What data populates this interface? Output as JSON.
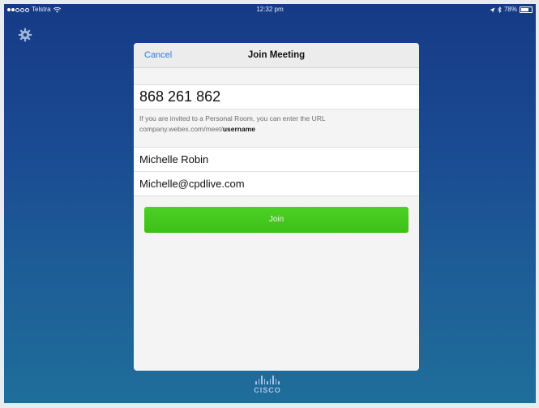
{
  "status_bar": {
    "carrier": "Telstra",
    "time": "12:32 pm",
    "battery": "78%"
  },
  "modal": {
    "cancel_label": "Cancel",
    "title": "Join Meeting",
    "meeting_number": "868 261 862",
    "hint_text": "If you are invited to a Personal Room, you can enter the URL company.webex.com/meet/",
    "hint_emphasis": "username",
    "name": "Michelle Robin",
    "email": "Michelle@cpdlive.com",
    "join_label": "Join"
  },
  "brand": {
    "logo_text": "CISCO"
  },
  "colors": {
    "background_top": "#163a86",
    "background_bottom": "#1f6e9a",
    "link_blue": "#2f7de1",
    "join_green": "#43c81f"
  },
  "icons": {
    "settings": "gear-icon",
    "wifi": "wifi-icon",
    "location": "location-arrow-icon",
    "bluetooth": "bluetooth-icon",
    "battery": "battery-icon"
  }
}
